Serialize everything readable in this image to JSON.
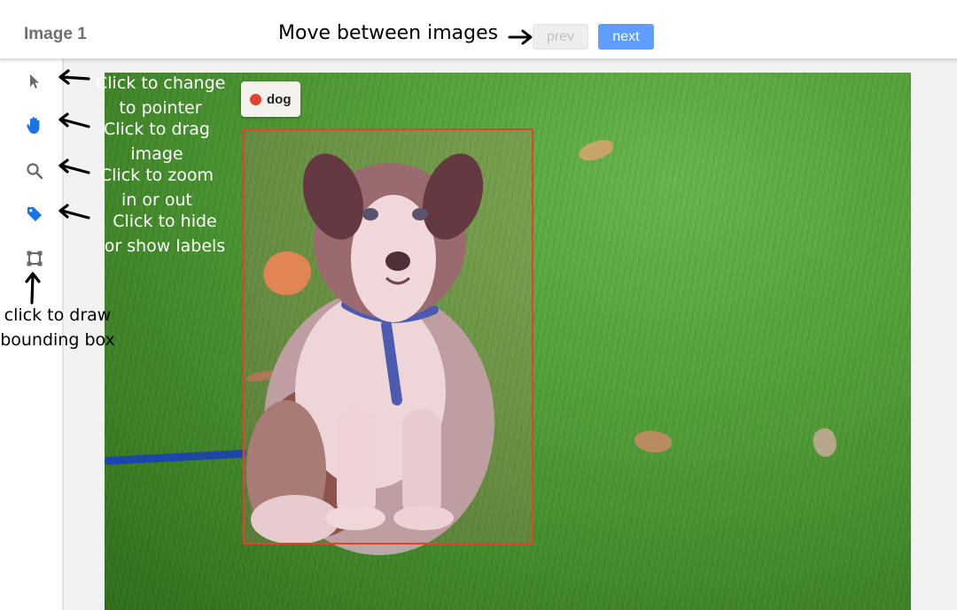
{
  "header": {
    "title": "Image 1",
    "annotation": "Move between images",
    "prev_label": "prev",
    "next_label": "next"
  },
  "toolbar": {
    "tools": [
      {
        "icon": "pointer-icon",
        "annotation_lines": [
          "Click to change",
          "to pointer"
        ]
      },
      {
        "icon": "hand-icon",
        "annotation_lines": [
          "Click to drag",
          "image"
        ]
      },
      {
        "icon": "magnifier-icon",
        "annotation_lines": [
          "Click to zoom",
          "in or out"
        ]
      },
      {
        "icon": "tag-icon",
        "annotation_lines": [
          "Click to hide",
          "or show labels"
        ]
      },
      {
        "icon": "bounding-box-icon",
        "annotation_lines": [
          "click to draw",
          "bounding box"
        ]
      }
    ]
  },
  "annotation": {
    "label": "dog",
    "label_color": "#e0442e"
  },
  "colors": {
    "accent": "#5e9eff",
    "tool_active": "#1a73e8",
    "box": "#e0442e"
  }
}
